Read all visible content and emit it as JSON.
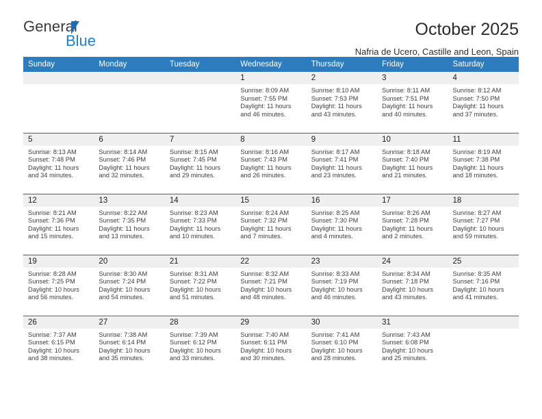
{
  "brand": {
    "name_part1": "General",
    "name_part2": "Blue",
    "triangle_icon": "blue-triangle",
    "accent_color": "#1b7fd4"
  },
  "header": {
    "title": "October 2025",
    "subtitle": "Nafria de Ucero, Castille and Leon, Spain"
  },
  "calendar": {
    "header_bg": "#2e7cc0",
    "date_strip_bg": "#efefef",
    "weekday_headers": [
      "Sunday",
      "Monday",
      "Tuesday",
      "Wednesday",
      "Thursday",
      "Friday",
      "Saturday"
    ],
    "weeks": [
      [
        {
          "empty": true,
          "date": "",
          "sunrise": "",
          "sunset": "",
          "daylight_line1": "",
          "daylight_line2": ""
        },
        {
          "empty": true,
          "date": "",
          "sunrise": "",
          "sunset": "",
          "daylight_line1": "",
          "daylight_line2": ""
        },
        {
          "empty": true,
          "date": "",
          "sunrise": "",
          "sunset": "",
          "daylight_line1": "",
          "daylight_line2": ""
        },
        {
          "empty": false,
          "date": "1",
          "sunrise": "Sunrise: 8:09 AM",
          "sunset": "Sunset: 7:55 PM",
          "daylight_line1": "Daylight: 11 hours",
          "daylight_line2": "and 46 minutes."
        },
        {
          "empty": false,
          "date": "2",
          "sunrise": "Sunrise: 8:10 AM",
          "sunset": "Sunset: 7:53 PM",
          "daylight_line1": "Daylight: 11 hours",
          "daylight_line2": "and 43 minutes."
        },
        {
          "empty": false,
          "date": "3",
          "sunrise": "Sunrise: 8:11 AM",
          "sunset": "Sunset: 7:51 PM",
          "daylight_line1": "Daylight: 11 hours",
          "daylight_line2": "and 40 minutes."
        },
        {
          "empty": false,
          "date": "4",
          "sunrise": "Sunrise: 8:12 AM",
          "sunset": "Sunset: 7:50 PM",
          "daylight_line1": "Daylight: 11 hours",
          "daylight_line2": "and 37 minutes."
        }
      ],
      [
        {
          "empty": false,
          "date": "5",
          "sunrise": "Sunrise: 8:13 AM",
          "sunset": "Sunset: 7:48 PM",
          "daylight_line1": "Daylight: 11 hours",
          "daylight_line2": "and 34 minutes."
        },
        {
          "empty": false,
          "date": "6",
          "sunrise": "Sunrise: 8:14 AM",
          "sunset": "Sunset: 7:46 PM",
          "daylight_line1": "Daylight: 11 hours",
          "daylight_line2": "and 32 minutes."
        },
        {
          "empty": false,
          "date": "7",
          "sunrise": "Sunrise: 8:15 AM",
          "sunset": "Sunset: 7:45 PM",
          "daylight_line1": "Daylight: 11 hours",
          "daylight_line2": "and 29 minutes."
        },
        {
          "empty": false,
          "date": "8",
          "sunrise": "Sunrise: 8:16 AM",
          "sunset": "Sunset: 7:43 PM",
          "daylight_line1": "Daylight: 11 hours",
          "daylight_line2": "and 26 minutes."
        },
        {
          "empty": false,
          "date": "9",
          "sunrise": "Sunrise: 8:17 AM",
          "sunset": "Sunset: 7:41 PM",
          "daylight_line1": "Daylight: 11 hours",
          "daylight_line2": "and 23 minutes."
        },
        {
          "empty": false,
          "date": "10",
          "sunrise": "Sunrise: 8:18 AM",
          "sunset": "Sunset: 7:40 PM",
          "daylight_line1": "Daylight: 11 hours",
          "daylight_line2": "and 21 minutes."
        },
        {
          "empty": false,
          "date": "11",
          "sunrise": "Sunrise: 8:19 AM",
          "sunset": "Sunset: 7:38 PM",
          "daylight_line1": "Daylight: 11 hours",
          "daylight_line2": "and 18 minutes."
        }
      ],
      [
        {
          "empty": false,
          "date": "12",
          "sunrise": "Sunrise: 8:21 AM",
          "sunset": "Sunset: 7:36 PM",
          "daylight_line1": "Daylight: 11 hours",
          "daylight_line2": "and 15 minutes."
        },
        {
          "empty": false,
          "date": "13",
          "sunrise": "Sunrise: 8:22 AM",
          "sunset": "Sunset: 7:35 PM",
          "daylight_line1": "Daylight: 11 hours",
          "daylight_line2": "and 13 minutes."
        },
        {
          "empty": false,
          "date": "14",
          "sunrise": "Sunrise: 8:23 AM",
          "sunset": "Sunset: 7:33 PM",
          "daylight_line1": "Daylight: 11 hours",
          "daylight_line2": "and 10 minutes."
        },
        {
          "empty": false,
          "date": "15",
          "sunrise": "Sunrise: 8:24 AM",
          "sunset": "Sunset: 7:32 PM",
          "daylight_line1": "Daylight: 11 hours",
          "daylight_line2": "and 7 minutes."
        },
        {
          "empty": false,
          "date": "16",
          "sunrise": "Sunrise: 8:25 AM",
          "sunset": "Sunset: 7:30 PM",
          "daylight_line1": "Daylight: 11 hours",
          "daylight_line2": "and 4 minutes."
        },
        {
          "empty": false,
          "date": "17",
          "sunrise": "Sunrise: 8:26 AM",
          "sunset": "Sunset: 7:28 PM",
          "daylight_line1": "Daylight: 11 hours",
          "daylight_line2": "and 2 minutes."
        },
        {
          "empty": false,
          "date": "18",
          "sunrise": "Sunrise: 8:27 AM",
          "sunset": "Sunset: 7:27 PM",
          "daylight_line1": "Daylight: 10 hours",
          "daylight_line2": "and 59 minutes."
        }
      ],
      [
        {
          "empty": false,
          "date": "19",
          "sunrise": "Sunrise: 8:28 AM",
          "sunset": "Sunset: 7:25 PM",
          "daylight_line1": "Daylight: 10 hours",
          "daylight_line2": "and 56 minutes."
        },
        {
          "empty": false,
          "date": "20",
          "sunrise": "Sunrise: 8:30 AM",
          "sunset": "Sunset: 7:24 PM",
          "daylight_line1": "Daylight: 10 hours",
          "daylight_line2": "and 54 minutes."
        },
        {
          "empty": false,
          "date": "21",
          "sunrise": "Sunrise: 8:31 AM",
          "sunset": "Sunset: 7:22 PM",
          "daylight_line1": "Daylight: 10 hours",
          "daylight_line2": "and 51 minutes."
        },
        {
          "empty": false,
          "date": "22",
          "sunrise": "Sunrise: 8:32 AM",
          "sunset": "Sunset: 7:21 PM",
          "daylight_line1": "Daylight: 10 hours",
          "daylight_line2": "and 48 minutes."
        },
        {
          "empty": false,
          "date": "23",
          "sunrise": "Sunrise: 8:33 AM",
          "sunset": "Sunset: 7:19 PM",
          "daylight_line1": "Daylight: 10 hours",
          "daylight_line2": "and 46 minutes."
        },
        {
          "empty": false,
          "date": "24",
          "sunrise": "Sunrise: 8:34 AM",
          "sunset": "Sunset: 7:18 PM",
          "daylight_line1": "Daylight: 10 hours",
          "daylight_line2": "and 43 minutes."
        },
        {
          "empty": false,
          "date": "25",
          "sunrise": "Sunrise: 8:35 AM",
          "sunset": "Sunset: 7:16 PM",
          "daylight_line1": "Daylight: 10 hours",
          "daylight_line2": "and 41 minutes."
        }
      ],
      [
        {
          "empty": false,
          "date": "26",
          "sunrise": "Sunrise: 7:37 AM",
          "sunset": "Sunset: 6:15 PM",
          "daylight_line1": "Daylight: 10 hours",
          "daylight_line2": "and 38 minutes."
        },
        {
          "empty": false,
          "date": "27",
          "sunrise": "Sunrise: 7:38 AM",
          "sunset": "Sunset: 6:14 PM",
          "daylight_line1": "Daylight: 10 hours",
          "daylight_line2": "and 35 minutes."
        },
        {
          "empty": false,
          "date": "28",
          "sunrise": "Sunrise: 7:39 AM",
          "sunset": "Sunset: 6:12 PM",
          "daylight_line1": "Daylight: 10 hours",
          "daylight_line2": "and 33 minutes."
        },
        {
          "empty": false,
          "date": "29",
          "sunrise": "Sunrise: 7:40 AM",
          "sunset": "Sunset: 6:11 PM",
          "daylight_line1": "Daylight: 10 hours",
          "daylight_line2": "and 30 minutes."
        },
        {
          "empty": false,
          "date": "30",
          "sunrise": "Sunrise: 7:41 AM",
          "sunset": "Sunset: 6:10 PM",
          "daylight_line1": "Daylight: 10 hours",
          "daylight_line2": "and 28 minutes."
        },
        {
          "empty": false,
          "date": "31",
          "sunrise": "Sunrise: 7:43 AM",
          "sunset": "Sunset: 6:08 PM",
          "daylight_line1": "Daylight: 10 hours",
          "daylight_line2": "and 25 minutes."
        },
        {
          "empty": true,
          "date": "",
          "sunrise": "",
          "sunset": "",
          "daylight_line1": "",
          "daylight_line2": ""
        }
      ]
    ]
  }
}
